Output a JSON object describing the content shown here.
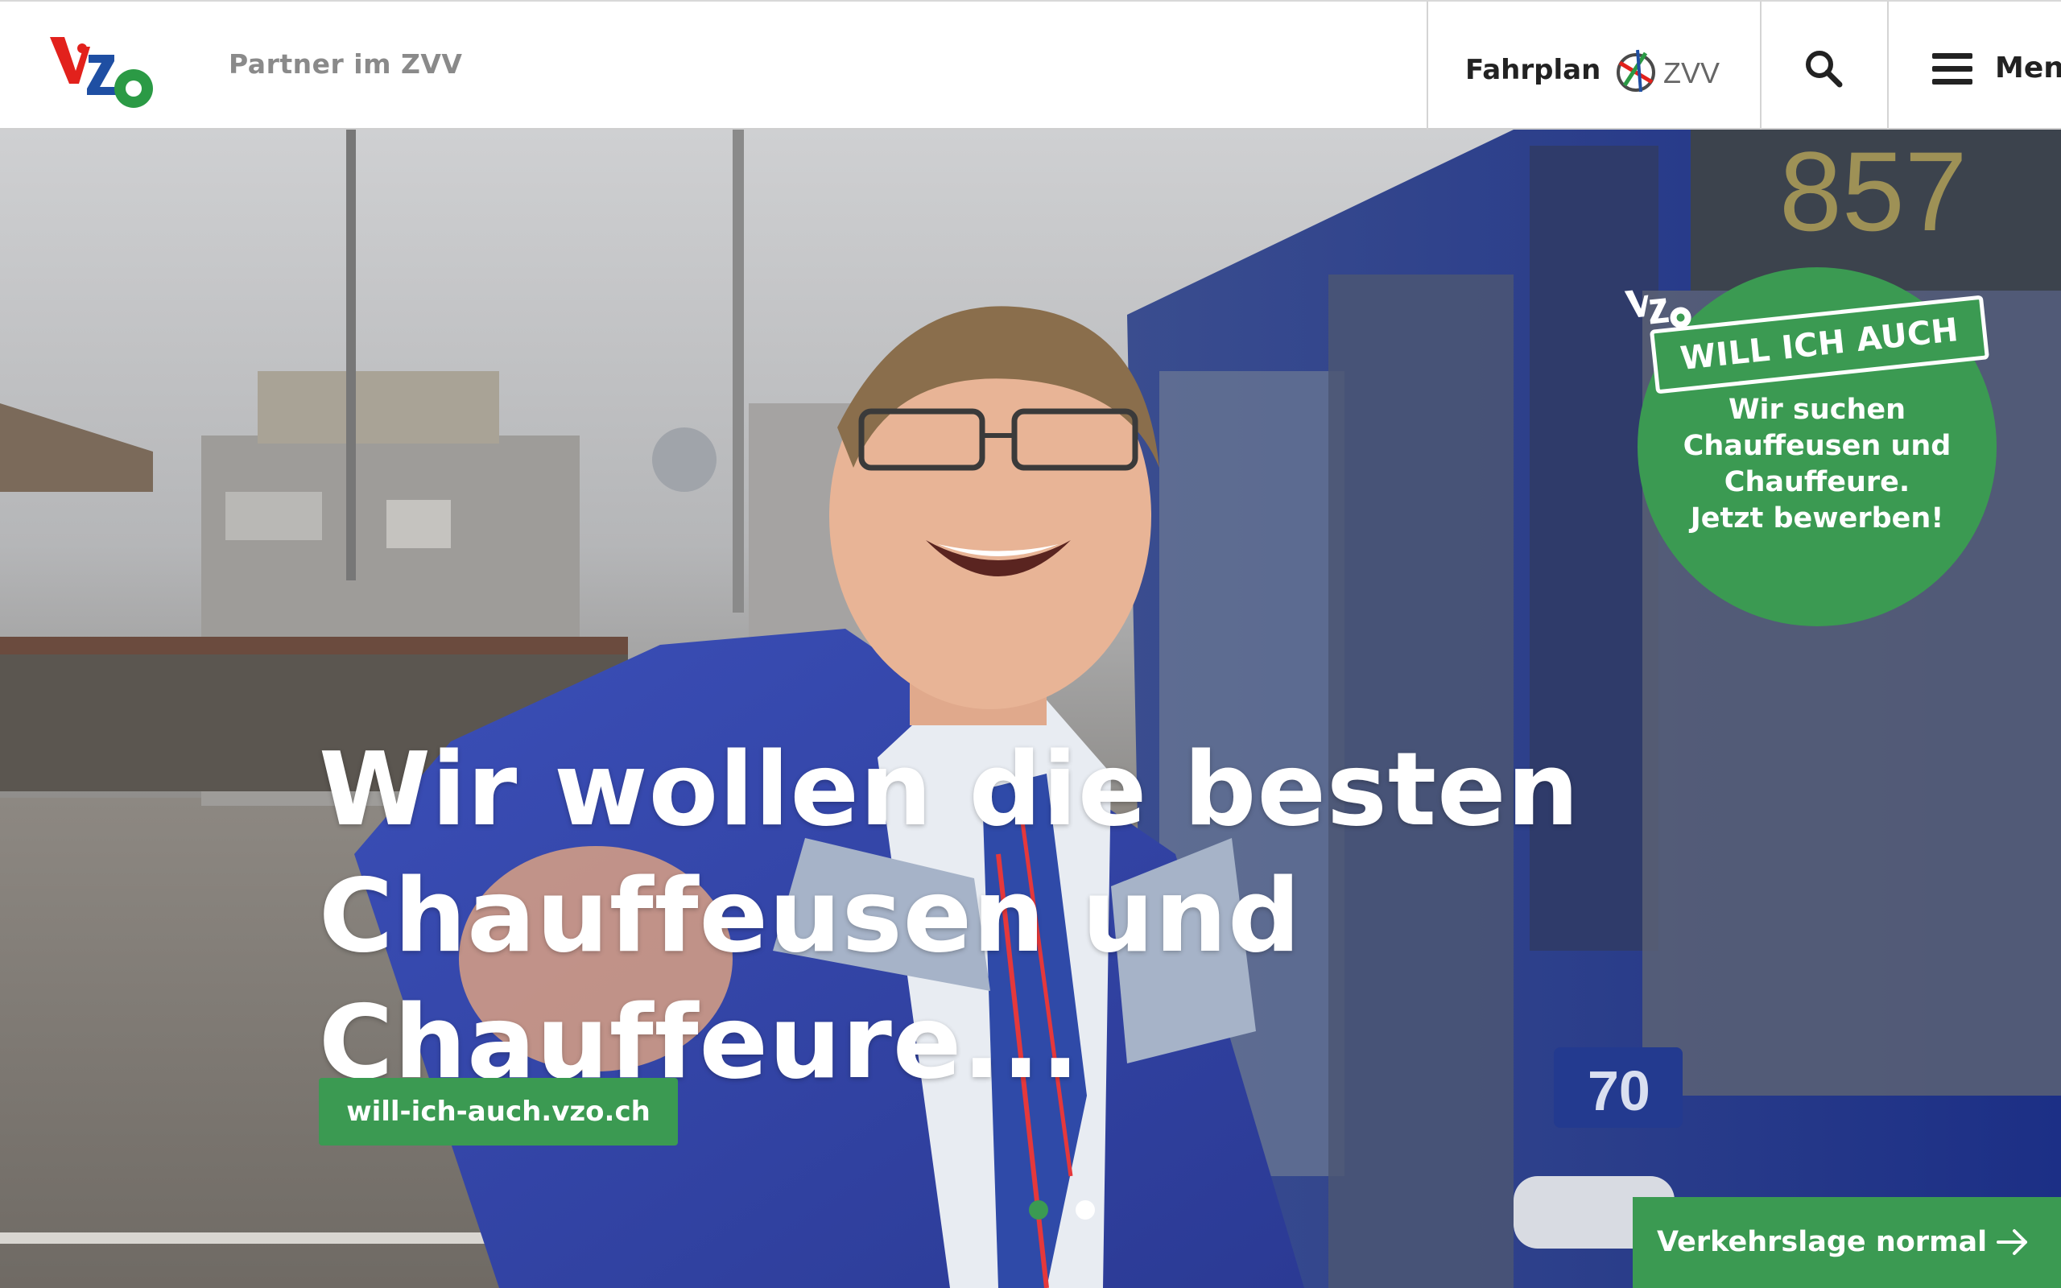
{
  "header": {
    "logo_text": "VZO",
    "partner_label": "Partner im ZVV",
    "fahrplan_label": "Fahrplan",
    "zvv_logo_text": "ZVV",
    "menu_label": "Menü"
  },
  "hero": {
    "headline_lines": [
      "Wir wollen die besten",
      "Chauffeusen und",
      "Chauffeure..."
    ],
    "cta_link_label": "will-ich-auch.vzo.ch",
    "badge": {
      "banner": "WILL ICH AUCH",
      "lines": [
        "Wir suchen",
        "Chauffeusen und",
        "Chauffeure.",
        "Jetzt bewerben!"
      ]
    },
    "slide_count": 2,
    "active_slide": 1,
    "traffic_status_label": "Verkehrslage normal",
    "bus_route_number": "857",
    "bus_fleet_number": "70"
  },
  "colors": {
    "brand_green": "#3b9a52",
    "logo_red": "#e2211c",
    "logo_blue": "#1f4fa3",
    "logo_green": "#2b9a45"
  },
  "icons": {
    "search": "search-icon",
    "menu": "hamburger-icon",
    "arrow": "arrow-right-icon"
  }
}
